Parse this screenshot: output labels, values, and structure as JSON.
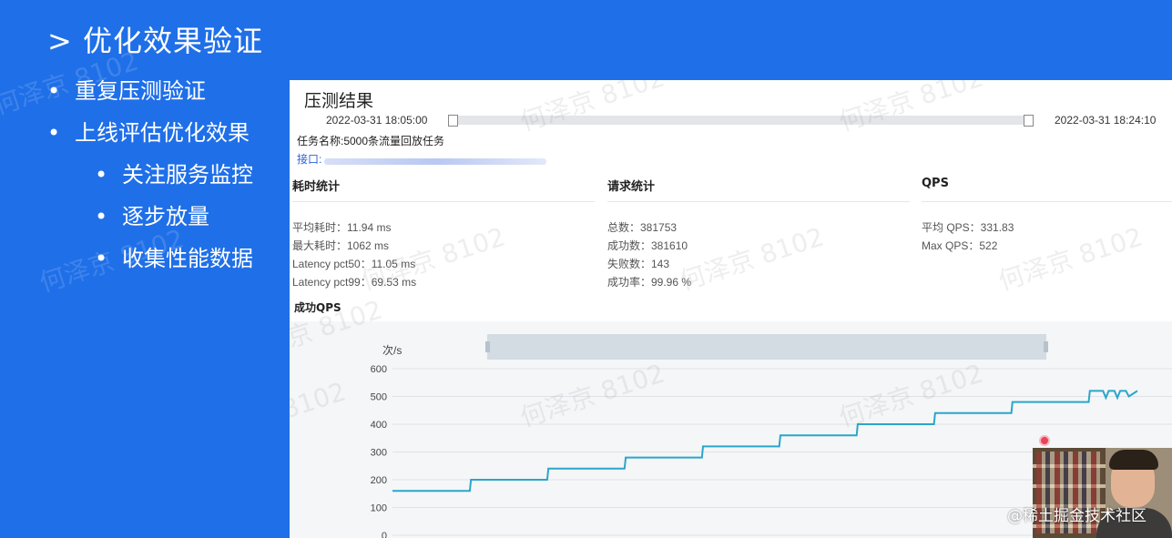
{
  "slide": {
    "title": "> 优化效果验证",
    "bullets": [
      {
        "text": "重复压测验证",
        "level": 1
      },
      {
        "text": "上线评估优化效果",
        "level": 1
      },
      {
        "text": "关注服务监控",
        "level": 2
      },
      {
        "text": "逐步放量",
        "level": 2
      },
      {
        "text": "收集性能数据",
        "level": 2
      }
    ],
    "bullet_glyph": "•",
    "watermark": "何泽京 8102"
  },
  "panel": {
    "title": "压测结果",
    "time_start": "2022-03-31 18:05:00",
    "time_end": "2022-03-31 18:24:10",
    "task_name": "任务名称:5000条流量回放任务",
    "interface_label": "接口:",
    "latency": {
      "heading": "耗时统计",
      "lines": [
        "平均耗时：11.94 ms",
        "最大耗时：1062 ms",
        "Latency pct50：11.05 ms",
        "Latency pct99：69.53 ms"
      ]
    },
    "requests": {
      "heading": "请求统计",
      "lines": [
        "总数：381753",
        "成功数：381610",
        "失败数：143",
        "成功率：99.96 %"
      ]
    },
    "qps": {
      "heading": "QPS",
      "lines": [
        "平均 QPS：331.83",
        "Max QPS：522"
      ]
    },
    "chart_title": "成功QPS"
  },
  "chart_data": {
    "type": "line",
    "title": "成功QPS",
    "ylabel": "次/s",
    "xlabel": "",
    "ylim": [
      0,
      600
    ],
    "yticks": [
      0,
      100,
      200,
      300,
      400,
      500,
      600
    ],
    "grid": true,
    "series": [
      {
        "color": "#2aa6c9",
        "x": [
          0,
          0.135,
          0.137,
          0.27,
          0.272,
          0.405,
          0.407,
          0.54,
          0.542,
          0.675,
          0.677,
          0.81,
          0.812,
          0.945,
          0.947,
          1.08,
          1.082,
          1.215,
          1.217,
          1.24,
          1.245,
          1.25,
          1.26,
          1.265,
          1.27,
          1.28,
          1.285,
          1.3
        ],
        "y": [
          160,
          160,
          200,
          200,
          240,
          240,
          280,
          280,
          320,
          320,
          360,
          360,
          400,
          400,
          440,
          440,
          480,
          480,
          520,
          520,
          495,
          520,
          520,
          495,
          520,
          520,
          500,
          520
        ]
      }
    ],
    "x_visible_max": 1.3
  },
  "overlay": {
    "brand": "@稀土掘金技术社区"
  },
  "colors": {
    "slide_bg": "#1f6fe8",
    "line": "#2aa6c9",
    "link": "#2b62d9"
  }
}
